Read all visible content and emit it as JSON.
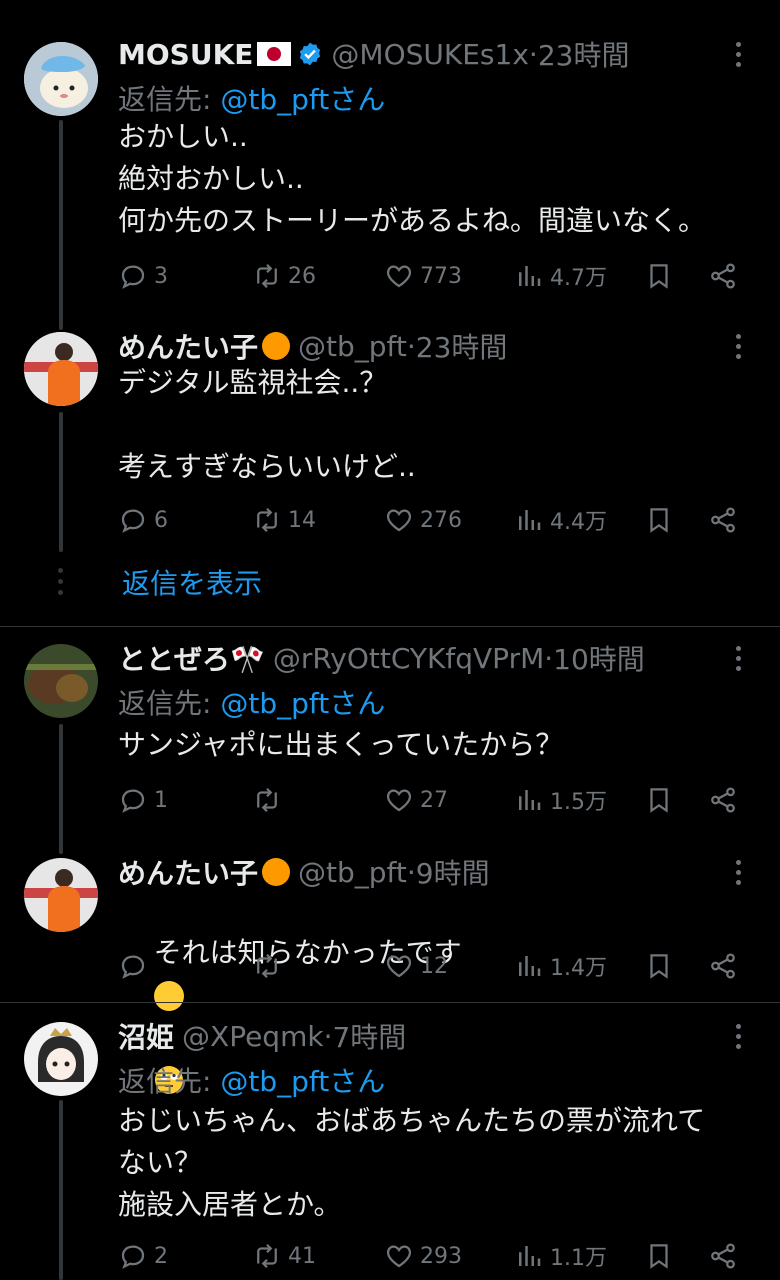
{
  "posts": [
    {
      "name": "MOSUKE",
      "handle": "@MOSUKEs1x",
      "time": "23時間",
      "reply_prefix": "返信先: ",
      "reply_handle": "@tb_pftさん",
      "body": "おかしい..\n絶対おかしい..\n何か先のストーリーがあるよね。間違いなく。",
      "replies": "3",
      "reposts": "26",
      "likes": "773",
      "views": "4.7万"
    },
    {
      "name": "めんたい子",
      "handle": "@tb_pft",
      "time": "23時間",
      "body": "デジタル監視社会..？\n\n考えすぎならいいけど..",
      "replies": "6",
      "reposts": "14",
      "likes": "276",
      "views": "4.4万"
    },
    {
      "name": "ととぜろ🎌",
      "handle": "@rRyOttCYKfqVPrM",
      "time": "10時間",
      "reply_prefix": "返信先: ",
      "reply_handle": "@tb_pftさん",
      "body": "サンジャポに出まくっていたから？",
      "replies": "1",
      "reposts": "",
      "likes": "27",
      "views": "1.5万"
    },
    {
      "name": "めんたい子",
      "handle": "@tb_pft",
      "time": "9時間",
      "body": "それは知らなかったです",
      "replies": "",
      "reposts": "",
      "likes": "12",
      "views": "1.4万"
    },
    {
      "name": "沼姫",
      "handle": "@XPeqmk",
      "time": "7時間",
      "reply_prefix": "返信先: ",
      "reply_handle": "@tb_pftさん",
      "body": "おじいちゃん、おばあちゃんたちの票が流れて\nない？\n施設入居者とか。",
      "replies": "2",
      "reposts": "41",
      "likes": "293",
      "views": "1.1万"
    }
  ],
  "show_replies_label": "返信を表示",
  "separator": " · ",
  "colors": {
    "accent": "#1d9bf0",
    "muted": "#71767b",
    "background": "#000000",
    "text": "#e7e9ea"
  }
}
